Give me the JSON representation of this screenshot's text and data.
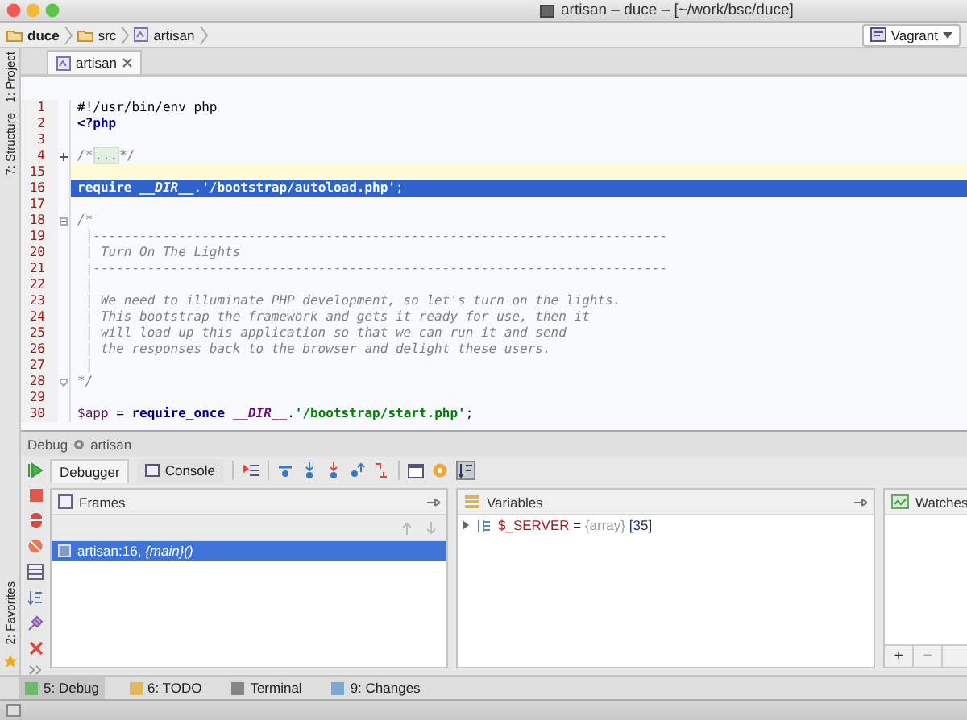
{
  "window": {
    "title": "artisan – duce – [~/work/bsc/duce]"
  },
  "breadcrumbs": [
    {
      "label": "duce",
      "kind": "folder"
    },
    {
      "label": "src",
      "kind": "folder"
    },
    {
      "label": "artisan",
      "kind": "file"
    }
  ],
  "run_config": {
    "label": "Vagrant"
  },
  "left_tools_top": [
    {
      "label": "1: Project"
    },
    {
      "label": "7: Structure"
    }
  ],
  "left_tools_bottom": [
    {
      "label": "2: Favorites"
    }
  ],
  "editor_tabs": [
    {
      "label": "artisan",
      "selected": true
    }
  ],
  "code_lines": [
    {
      "number": "1",
      "selected": false,
      "caret": false,
      "tokens": [
        {
          "kind": "text",
          "text": "#!/usr/bin/env php"
        }
      ]
    },
    {
      "number": "2",
      "selected": false,
      "caret": false,
      "tokens": [
        {
          "kind": "keyword",
          "text": "<?php"
        }
      ]
    },
    {
      "number": "3",
      "selected": false,
      "caret": false
    },
    {
      "number": "4",
      "selected": false,
      "caret": false,
      "kind": "fold_collapsed",
      "tokens": [
        {
          "kind": "comment",
          "text": "/*"
        },
        {
          "kind": "folded",
          "text": "..."
        },
        {
          "kind": "comment",
          "text": "*/"
        }
      ]
    },
    {
      "number": "15",
      "selected": false,
      "caret": true
    },
    {
      "number": "16",
      "selected": true,
      "caret": false,
      "tokens": [
        {
          "kind": "keyword",
          "text": "require "
        },
        {
          "kind": "const",
          "text": "__DIR__"
        },
        {
          "kind": "text",
          "text": "."
        },
        {
          "kind": "string",
          "text": "'/bootstrap/autoload.php'"
        },
        {
          "kind": "text",
          "text": ";"
        }
      ]
    },
    {
      "number": "17",
      "selected": false,
      "caret": false
    },
    {
      "number": "18",
      "selected": false,
      "caret": false,
      "kind": "fold_start",
      "tokens": [
        {
          "kind": "comment",
          "text": "/*"
        }
      ]
    },
    {
      "number": "19",
      "selected": false,
      "caret": false,
      "tokens": [
        {
          "kind": "comment",
          "text": " |--------------------------------------------------------------------------"
        }
      ]
    },
    {
      "number": "20",
      "selected": false,
      "caret": false,
      "tokens": [
        {
          "kind": "comment",
          "text": " | Turn On The Lights"
        }
      ]
    },
    {
      "number": "21",
      "selected": false,
      "caret": false,
      "tokens": [
        {
          "kind": "comment",
          "text": " |--------------------------------------------------------------------------"
        }
      ]
    },
    {
      "number": "22",
      "selected": false,
      "caret": false,
      "tokens": [
        {
          "kind": "comment",
          "text": " |"
        }
      ]
    },
    {
      "number": "23",
      "selected": false,
      "caret": false,
      "tokens": [
        {
          "kind": "comment",
          "text": " | We need to illuminate PHP development, so let's turn on the lights."
        }
      ]
    },
    {
      "number": "24",
      "selected": false,
      "caret": false,
      "tokens": [
        {
          "kind": "comment",
          "text": " | This bootstrap the framework and gets it ready for use, then it"
        }
      ]
    },
    {
      "number": "25",
      "selected": false,
      "caret": false,
      "tokens": [
        {
          "kind": "comment",
          "text": " | will load up this application so that we can run it and send"
        }
      ]
    },
    {
      "number": "26",
      "selected": false,
      "caret": false,
      "tokens": [
        {
          "kind": "comment",
          "text": " | the responses back to the browser and delight these users."
        }
      ]
    },
    {
      "number": "27",
      "selected": false,
      "caret": false,
      "tokens": [
        {
          "kind": "comment",
          "text": " |"
        }
      ]
    },
    {
      "number": "28",
      "selected": false,
      "caret": false,
      "kind": "fold_end",
      "tokens": [
        {
          "kind": "comment",
          "text": "*/"
        }
      ]
    },
    {
      "number": "29",
      "selected": false,
      "caret": false
    },
    {
      "number": "30",
      "selected": false,
      "caret": false,
      "tokens": [
        {
          "kind": "var",
          "text": "$app"
        },
        {
          "kind": "text",
          "text": " = "
        },
        {
          "kind": "keyword",
          "text": "require_once "
        },
        {
          "kind": "const",
          "text": "__DIR__"
        },
        {
          "kind": "text",
          "text": "."
        },
        {
          "kind": "string",
          "text": "'/bootstrap/start.php'"
        },
        {
          "kind": "text",
          "text": ";"
        }
      ]
    }
  ],
  "debug": {
    "title": "Debug",
    "config": "artisan",
    "tabs": [
      {
        "label": "Debugger",
        "selected": true
      },
      {
        "label": "Console",
        "selected": false
      }
    ],
    "frames": {
      "title": "Frames",
      "rows": [
        {
          "text": "artisan:16, *{main}()*",
          "selected": true
        }
      ]
    },
    "variables": {
      "title": "Variables",
      "rows": [
        {
          "name": "$_SERVER",
          "op": "=",
          "type": "{array}",
          "count": "[35]",
          "expanded": false
        }
      ]
    },
    "watches": {
      "title": "Watches",
      "buttons": [
        "+",
        "−"
      ]
    }
  },
  "bottom_tools": [
    {
      "label": "5: Debug",
      "selected": true
    },
    {
      "label": "6: TODO",
      "selected": false
    },
    {
      "label": "Terminal",
      "selected": false
    },
    {
      "label": "9: Changes",
      "selected": false
    }
  ]
}
